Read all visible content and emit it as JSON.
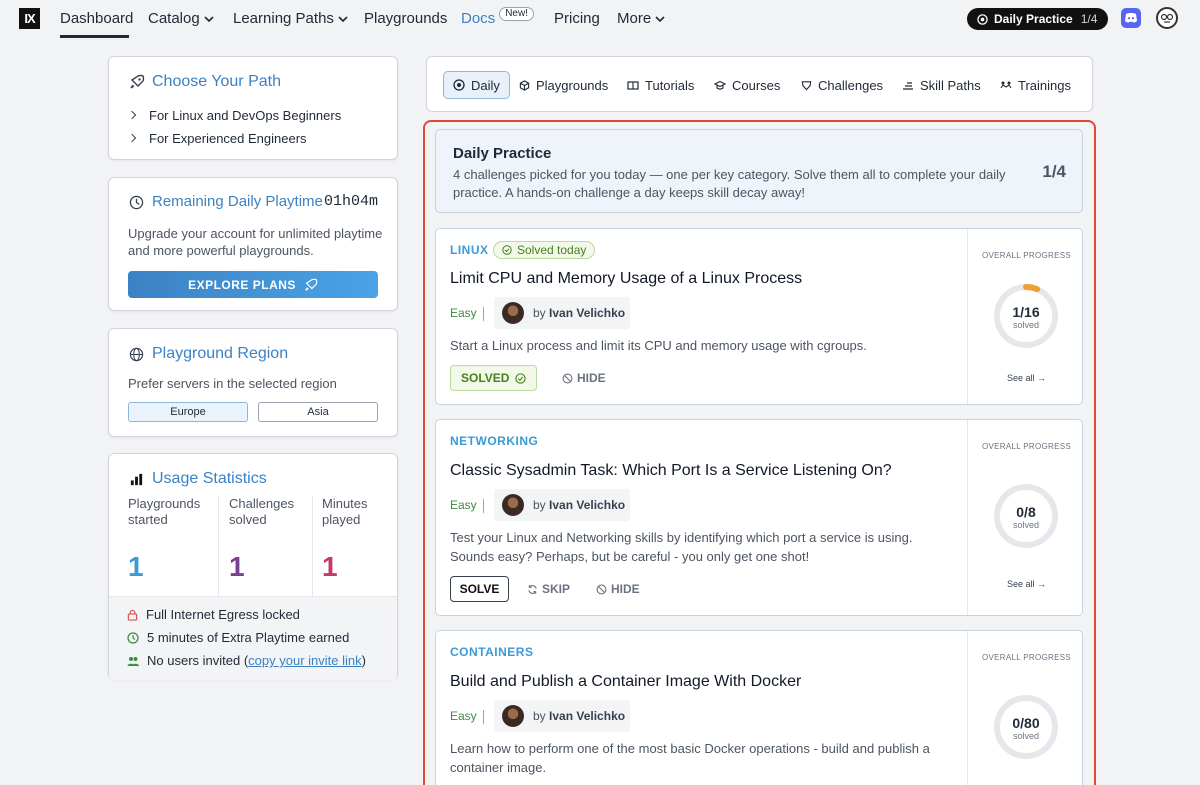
{
  "nav": {
    "logo": "IX",
    "items": [
      "Dashboard",
      "Catalog",
      "Learning Paths",
      "Playgrounds",
      "Docs",
      "Pricing",
      "More"
    ],
    "docs_badge": "New!",
    "daily_practice_label": "Daily Practice",
    "daily_practice_progress": "1/4"
  },
  "path_card": {
    "title": "Choose Your Path",
    "items": [
      "For Linux and DevOps Beginners",
      "For Experienced Engineers"
    ]
  },
  "playtime_card": {
    "title": "Remaining Daily Playtime",
    "time": "01h04m",
    "description": "Upgrade your account for unlimited playtime and more powerful playgrounds.",
    "button": "EXPLORE PLANS"
  },
  "region_card": {
    "title": "Playground Region",
    "description": "Prefer servers in the selected region",
    "options": [
      "Europe",
      "Asia"
    ],
    "selected": "Europe"
  },
  "stats_card": {
    "title": "Usage Statistics",
    "stats": [
      {
        "label_line1": "Playgrounds",
        "label_line2": "started",
        "value": "1",
        "color": "#3b9ad6"
      },
      {
        "label_line1": "Challenges",
        "label_line2": "solved",
        "value": "1",
        "color": "#7b3f8f"
      },
      {
        "label_line1": "Minutes",
        "label_line2": "played",
        "value": "1",
        "color": "#c23b6a"
      }
    ],
    "footer": [
      {
        "icon": "lock-icon",
        "text": "Full Internet Egress locked"
      },
      {
        "icon": "clock-icon",
        "text": "5 minutes of Extra Playtime earned"
      },
      {
        "icon": "users-icon",
        "text_before": "No users invited (",
        "link": "copy your invite link",
        "text_after": ")"
      }
    ]
  },
  "tabs": [
    "Daily",
    "Playgrounds",
    "Tutorials",
    "Courses",
    "Challenges",
    "Skill Paths",
    "Trainings"
  ],
  "daily_practice": {
    "title": "Daily Practice",
    "description": "4 challenges picked for you today — one per key category. Solve them all to complete your daily practice. A hands-on challenge a day keeps skill decay away!",
    "progress": "1/4"
  },
  "challenges": [
    {
      "category": "LINUX",
      "badge": "Solved today",
      "title": "Limit CPU and Memory Usage of a Linux Process",
      "difficulty": "Easy",
      "author_prefix": "by",
      "author": "Ivan Velichko",
      "description": "Start a Linux process and limit its CPU and memory usage with cgroups.",
      "actions": [
        "SOLVED",
        "HIDE"
      ],
      "progress_label": "OVERALL PROGRESS",
      "progress_fraction": "1/16",
      "progress_value": 0.0625,
      "progress_sub": "solved",
      "see_all": "See all →"
    },
    {
      "category": "NETWORKING",
      "title": "Classic Sysadmin Task: Which Port Is a Service Listening On?",
      "difficulty": "Easy",
      "author_prefix": "by",
      "author": "Ivan Velichko",
      "description": "Test your Linux and Networking skills by identifying which port a service is using. Sounds easy? Perhaps, but be careful - you only get one shot!",
      "actions": [
        "SOLVE",
        "SKIP",
        "HIDE"
      ],
      "progress_label": "OVERALL PROGRESS",
      "progress_fraction": "0/8",
      "progress_value": 0,
      "progress_sub": "solved",
      "see_all": "See all →"
    },
    {
      "category": "CONTAINERS",
      "title": "Build and Publish a Container Image With Docker",
      "difficulty": "Easy",
      "author_prefix": "by",
      "author": "Ivan Velichko",
      "description": "Learn how to perform one of the most basic Docker operations - build and publish a container image.",
      "progress_label": "OVERALL PROGRESS",
      "progress_fraction": "0/80",
      "progress_value": 0,
      "progress_sub": "solved"
    }
  ]
}
